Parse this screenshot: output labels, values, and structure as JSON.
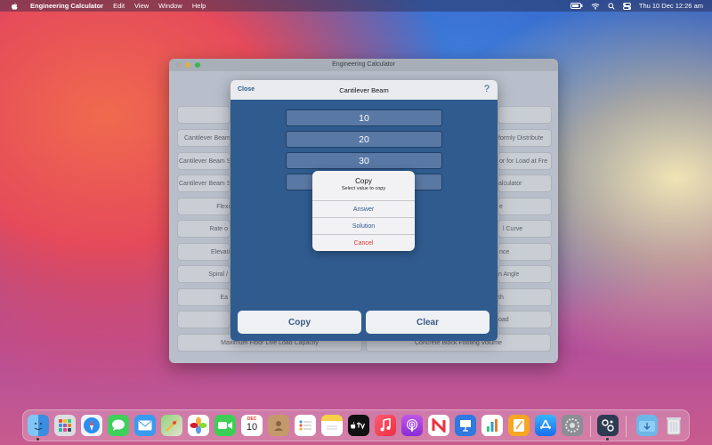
{
  "menubar": {
    "app_name": "Engineering Calculator",
    "menus": [
      "Edit",
      "View",
      "Window",
      "Help"
    ],
    "clock": "Thu 10 Dec  12:26 am"
  },
  "window": {
    "title": "Engineering Calculator",
    "left_buttons": [
      "",
      "Cantilever Beam",
      "Cantilever Beam Sl",
      "Cantilever Beam Sl",
      "Flexi",
      "Rate o",
      "Elevati",
      "Spiral /",
      "Ea",
      "",
      "Maximum Floor Live Load Capacity"
    ],
    "right_buttons": [
      "",
      "formly Distribute",
      "or for Load at Fre",
      "alculator",
      "e",
      "l Curve",
      "nce",
      "n Angle",
      "th",
      "oad",
      "Concrete Block Footing Volume"
    ]
  },
  "sheet": {
    "close_label": "Close",
    "title": "Cantilever Beam",
    "help_label": "?",
    "values": [
      "10",
      "20",
      "30",
      ""
    ],
    "copy_label": "Copy",
    "clear_label": "Clear"
  },
  "alert": {
    "title": "Copy",
    "message": "Select value to copy",
    "options": [
      "Answer",
      "Solution",
      "Cancel"
    ]
  },
  "calendar_icon": {
    "month": "DEC",
    "day": "10"
  },
  "dock_icons": [
    "finder-icon",
    "launchpad-icon",
    "safari-icon",
    "messages-icon",
    "mail-icon",
    "maps-icon",
    "photos-icon",
    "facetime-icon",
    "calendar-icon",
    "contacts-icon",
    "reminders-icon",
    "notes-icon",
    "tv-icon",
    "music-icon",
    "podcasts-icon",
    "news-icon",
    "keynote-icon",
    "numbers-icon",
    "pages-icon",
    "app-store-icon",
    "system-preferences-icon",
    "engineering-calculator-icon",
    "downloads-folder-icon",
    "trash-icon"
  ],
  "colors": {
    "sheet_blue": "#2f5b8f",
    "cancel_red": "#e23a2f",
    "accent_link": "#2f5b8f"
  }
}
